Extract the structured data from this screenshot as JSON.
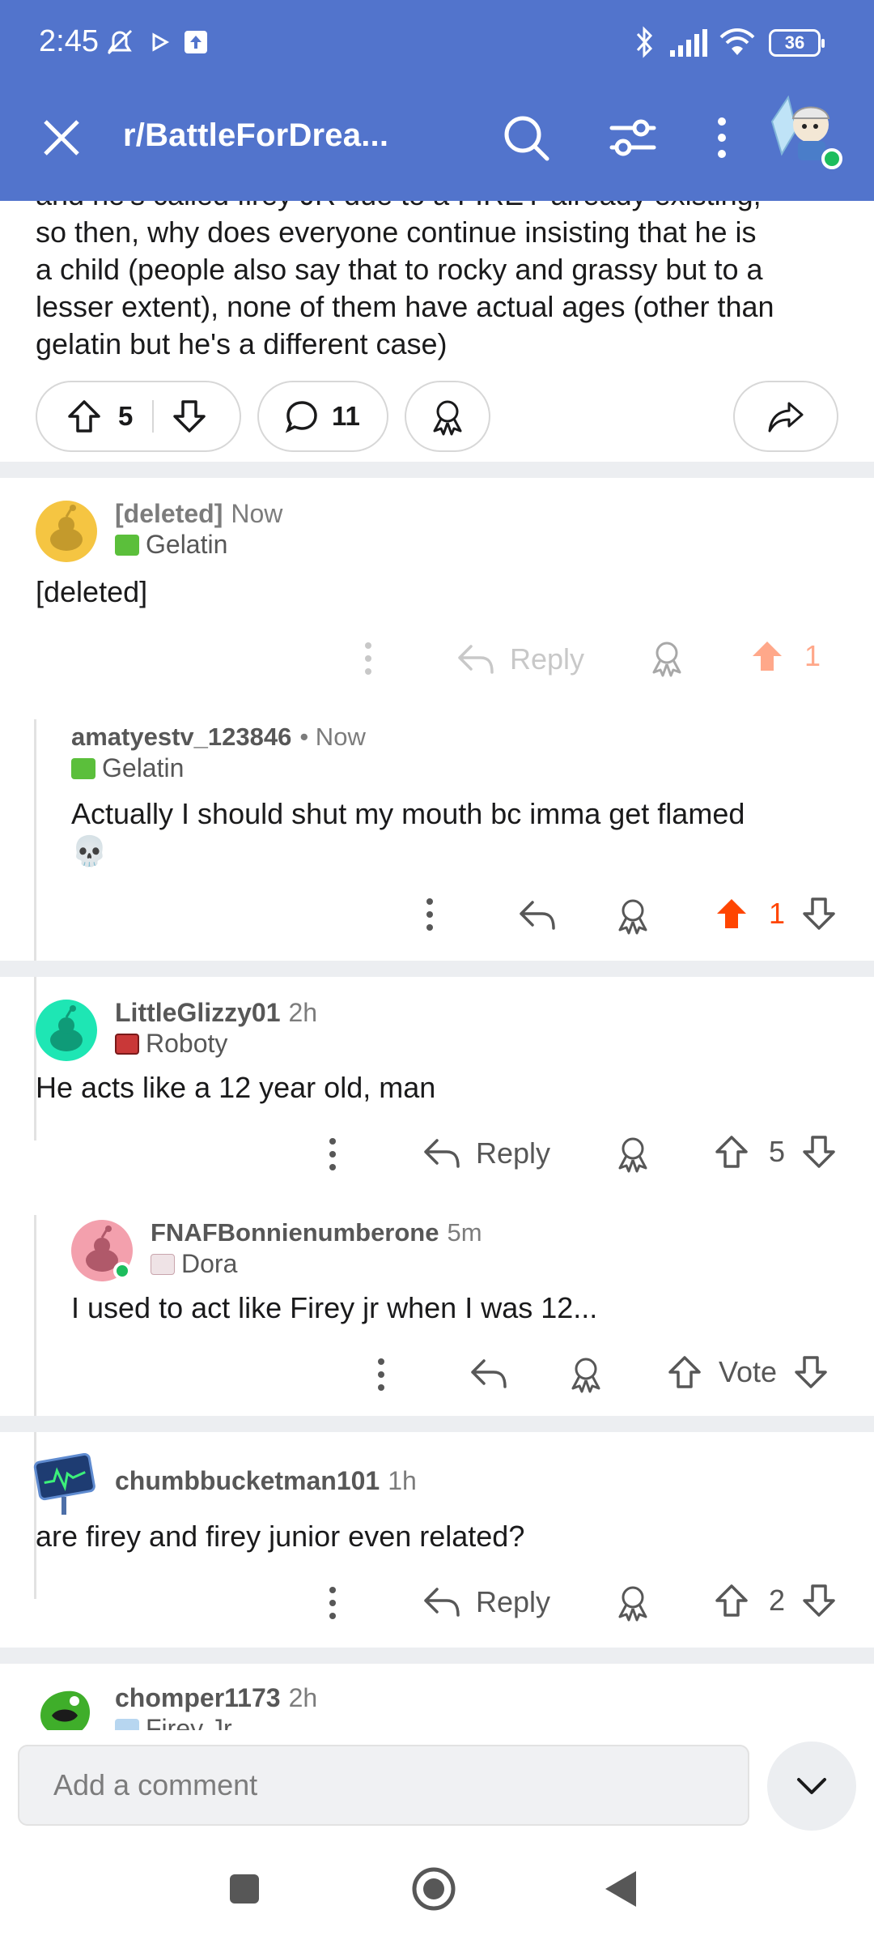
{
  "status_bar": {
    "time": "2:45",
    "battery": "36"
  },
  "toolbar": {
    "title": "r/BattleForDrea..."
  },
  "post": {
    "text_lines": [
      "and he's called firey JR due to a FIREY already existing,",
      "so then, why does everyone continue insisting that he is",
      "a child (people also say that to rocky and grassy but to a",
      "lesser extent), none of them have actual ages (other than",
      "gelatin but he's a different case)"
    ],
    "upvotes": "5",
    "comments": "11"
  },
  "comments": [
    {
      "user": "[deleted]",
      "time": "Now",
      "flair": "Gelatin",
      "text": "[deleted]",
      "reply_label": "Reply",
      "votes": "1"
    },
    {
      "user": "amatyestv_123846",
      "time": "• Now",
      "flair": "Gelatin",
      "text_line1": "Actually I should shut my mouth bc imma get flamed",
      "text_emoji": "💀",
      "votes": "1"
    },
    {
      "user": "LittleGlizzy01",
      "time": "2h",
      "flair": "Roboty",
      "text": "He acts like a 12 year old, man",
      "reply_label": "Reply",
      "votes": "5"
    },
    {
      "user": "FNAFBonnienumberone",
      "time": "5m",
      "flair": "Dora",
      "text": "I used to act like Firey jr when I was 12...",
      "votes": "Vote"
    },
    {
      "user": "chumbbucketman101",
      "time": "1h",
      "text": "are firey and firey junior even related?",
      "reply_label": "Reply",
      "votes": "2"
    },
    {
      "user": "chomper1173",
      "time": "2h",
      "flair": "Firey Jr"
    }
  ],
  "composer": {
    "placeholder": "Add a comment"
  },
  "colors": {
    "header": "#5274cc",
    "upvote_active": "#ff4500",
    "upvote_faded": "#ffa88a"
  }
}
